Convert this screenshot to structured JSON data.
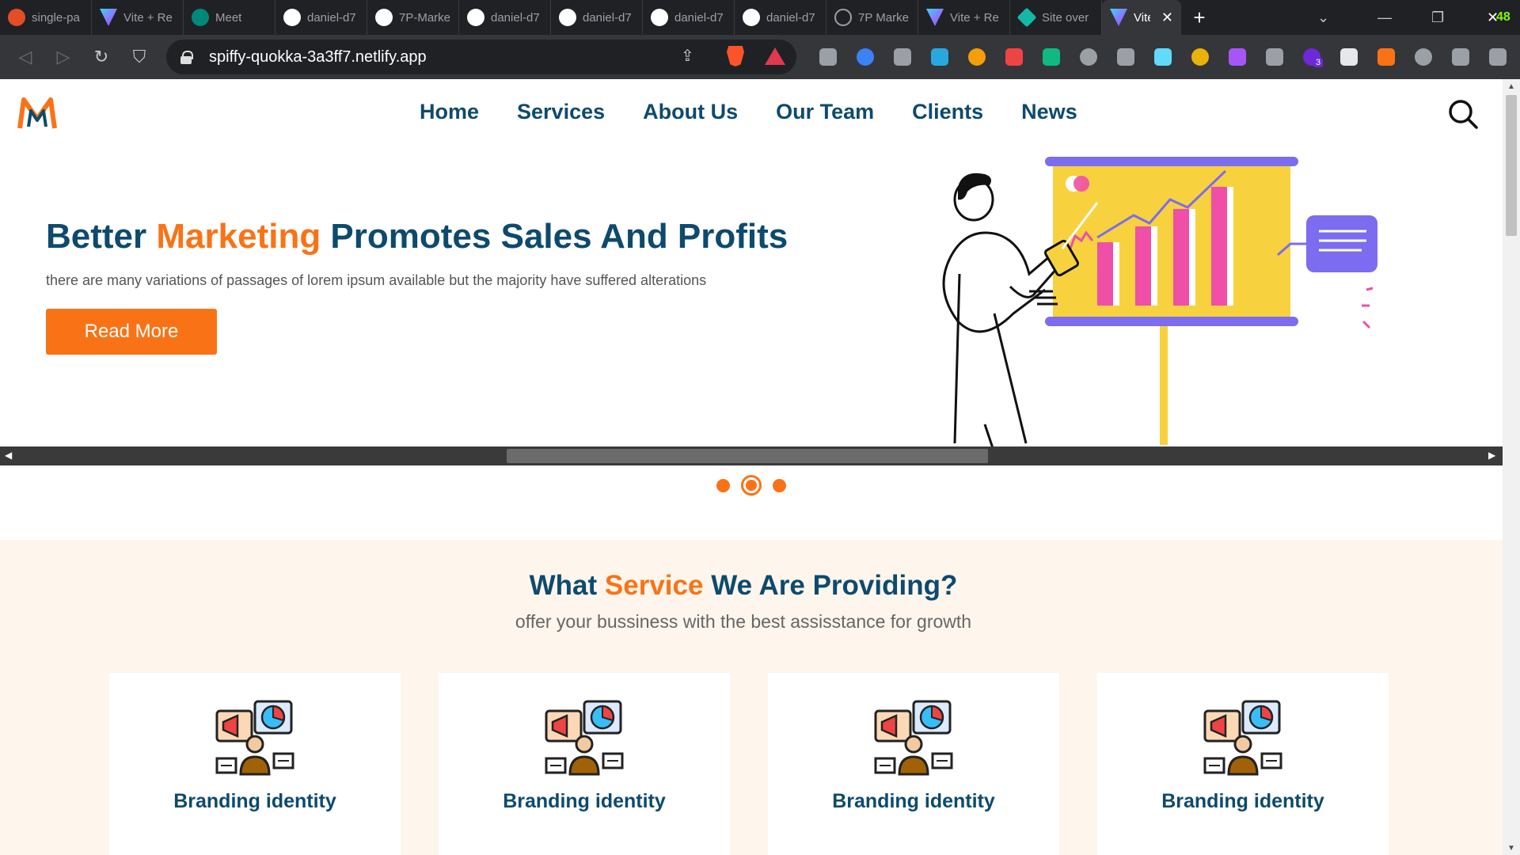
{
  "browser": {
    "tabs": [
      {
        "title": "single-pa",
        "favicon_color": "#e44d26",
        "favicon_glyph": "figma"
      },
      {
        "title": "Vite + Re",
        "favicon_color": "#9d5cff",
        "favicon_glyph": "vite"
      },
      {
        "title": "Meet",
        "favicon_color": "#00897b",
        "favicon_glyph": "meet"
      },
      {
        "title": "daniel-d7",
        "favicon_color": "#ffffff",
        "favicon_glyph": "github"
      },
      {
        "title": "7P-Marke",
        "favicon_color": "#ffffff",
        "favicon_glyph": "github"
      },
      {
        "title": "daniel-d7",
        "favicon_color": "#ffffff",
        "favicon_glyph": "github"
      },
      {
        "title": "daniel-d7",
        "favicon_color": "#ffffff",
        "favicon_glyph": "github"
      },
      {
        "title": "daniel-d7",
        "favicon_color": "#ffffff",
        "favicon_glyph": "github"
      },
      {
        "title": "daniel-d7",
        "favicon_color": "#ffffff",
        "favicon_glyph": "github"
      },
      {
        "title": "7P Marke",
        "favicon_color": "#9aa0a6",
        "favicon_glyph": "github-outline"
      },
      {
        "title": "Vite + Re",
        "favicon_color": "#9d5cff",
        "favicon_glyph": "vite"
      },
      {
        "title": "Site over",
        "favicon_color": "#14b8a6",
        "favicon_glyph": "netlify"
      },
      {
        "title": "Vite",
        "favicon_color": "#9d5cff",
        "favicon_glyph": "vite",
        "active": true
      }
    ],
    "close_tab_glyph": "✕",
    "new_tab_glyph": "+",
    "window_badge": "48",
    "url": "spiffy-quokka-3a3ff7.netlify.app",
    "extension_colors": [
      "#9aa0a6",
      "#3b82f6",
      "#9aa0a6",
      "#29a8e0",
      "#f59e0b",
      "#ef4444",
      "#10b981",
      "#9aa0a6",
      "#9aa0a6",
      "#61dafb",
      "#eab308",
      "#a855f7",
      "#9aa0a6",
      "#6d28d9",
      "#e5e7eb",
      "#f97316",
      "#9aa0a6",
      "#9aa0a6",
      "#9aa0a6"
    ],
    "extension_badge": "3"
  },
  "site": {
    "nav": [
      "Home",
      "Services",
      "About Us",
      "Our Team",
      "Clients",
      "News"
    ],
    "hero": {
      "title_part1": "Better ",
      "title_accent": "Marketing",
      "title_part2": " Promotes Sales And Profits",
      "subtitle": "there are many variations of passages of lorem ipsum available but the majority have suffered alterations",
      "button": "Read More"
    },
    "services": {
      "title_part1": "What ",
      "title_accent": "Service",
      "title_part2": " We Are Providing?",
      "subtitle": "offer your bussiness with the best assisstance for growth",
      "cards": [
        {
          "title": "Branding identity"
        },
        {
          "title": "Branding identity"
        },
        {
          "title": "Branding identity"
        },
        {
          "title": "Branding identity"
        }
      ]
    },
    "colors": {
      "primary": "#0d4a6e",
      "accent": "#f97316",
      "services_bg": "#fef5ec"
    }
  }
}
